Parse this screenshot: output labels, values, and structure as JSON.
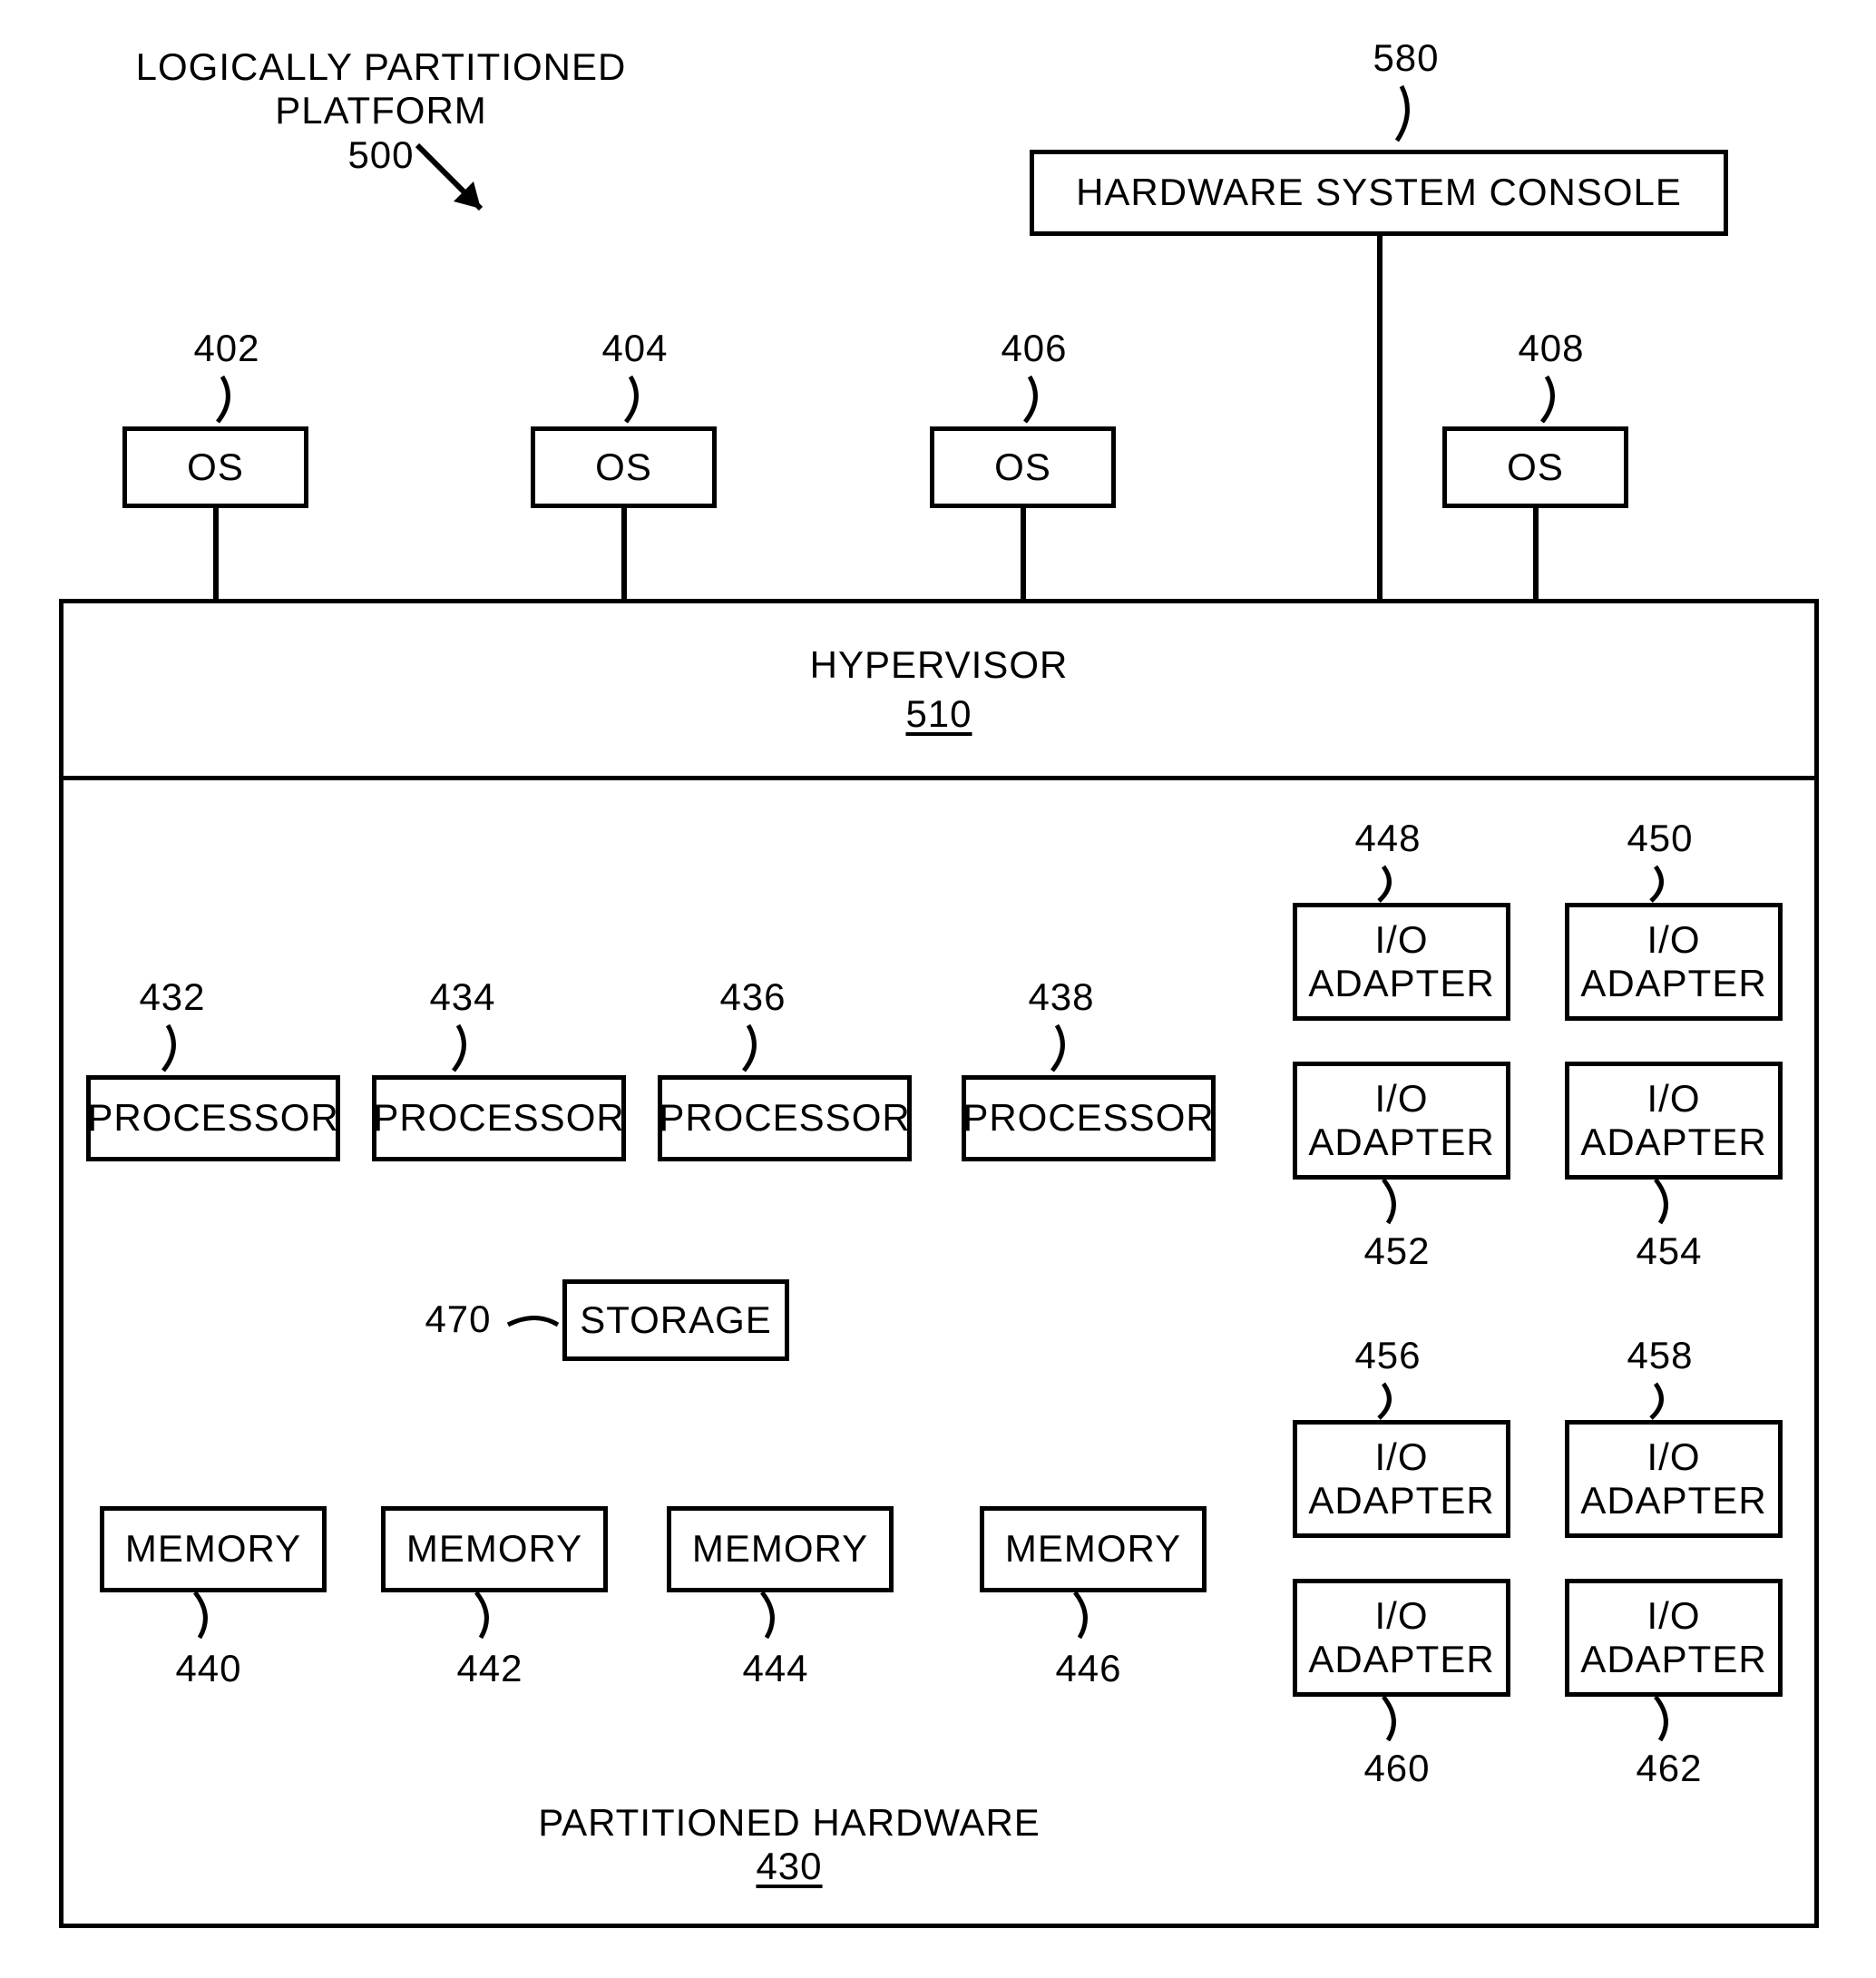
{
  "title": {
    "text": "LOGICALLY PARTITIONED PLATFORM",
    "ref": "500"
  },
  "console": {
    "label": "HARDWARE SYSTEM CONSOLE",
    "ref": "580"
  },
  "os": [
    {
      "label": "OS",
      "ref": "402"
    },
    {
      "label": "OS",
      "ref": "404"
    },
    {
      "label": "OS",
      "ref": "406"
    },
    {
      "label": "OS",
      "ref": "408"
    }
  ],
  "hypervisor": {
    "label": "HYPERVISOR",
    "ref": "510"
  },
  "partitioned_hw": {
    "label": "PARTITIONED HARDWARE",
    "ref": "430"
  },
  "processors": [
    {
      "label": "PROCESSOR",
      "ref": "432"
    },
    {
      "label": "PROCESSOR",
      "ref": "434"
    },
    {
      "label": "PROCESSOR",
      "ref": "436"
    },
    {
      "label": "PROCESSOR",
      "ref": "438"
    }
  ],
  "storage": {
    "label": "STORAGE",
    "ref": "470"
  },
  "memories": [
    {
      "label": "MEMORY",
      "ref": "440"
    },
    {
      "label": "MEMORY",
      "ref": "442"
    },
    {
      "label": "MEMORY",
      "ref": "444"
    },
    {
      "label": "MEMORY",
      "ref": "446"
    }
  ],
  "io_adapters": [
    {
      "label": "I/O\nADAPTER",
      "ref": "448"
    },
    {
      "label": "I/O\nADAPTER",
      "ref": "450"
    },
    {
      "label": "I/O\nADAPTER",
      "ref": "452"
    },
    {
      "label": "I/O\nADAPTER",
      "ref": "454"
    },
    {
      "label": "I/O\nADAPTER",
      "ref": "456"
    },
    {
      "label": "I/O\nADAPTER",
      "ref": "458"
    },
    {
      "label": "I/O\nADAPTER",
      "ref": "460"
    },
    {
      "label": "I/O\nADAPTER",
      "ref": "462"
    }
  ]
}
